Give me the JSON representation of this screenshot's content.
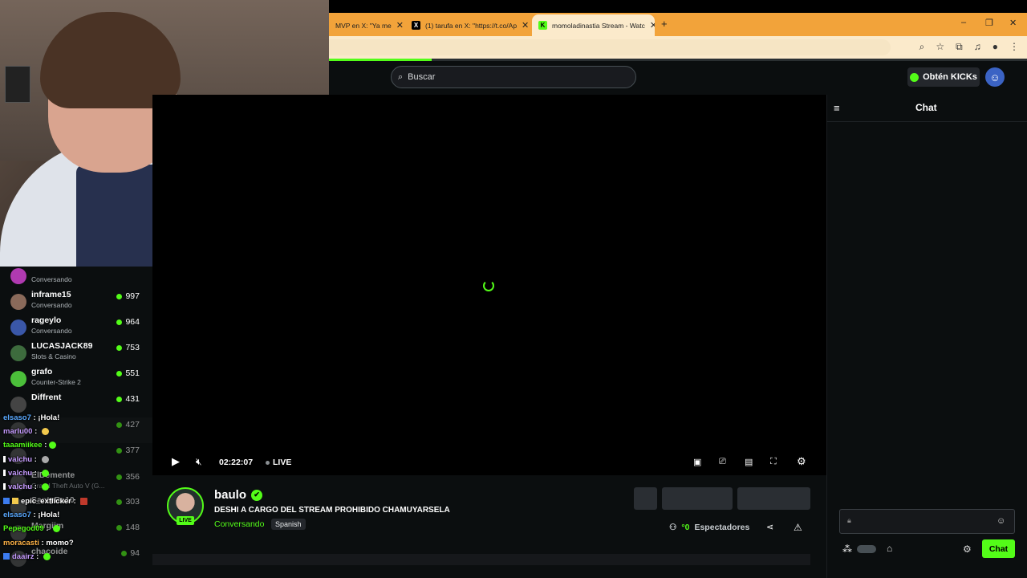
{
  "browser": {
    "tabs": [
      {
        "label": "MVP en X: \"Ya me",
        "icon": ""
      },
      {
        "label": "(1) tarufa en X: \"https://t.co/Ap",
        "icon": "X"
      },
      {
        "label": "momoladinastia Stream - Watc",
        "icon": "K"
      }
    ],
    "new_tab": "+",
    "window_controls": {
      "minimize": "–",
      "maximize": "❐",
      "close": "✕"
    }
  },
  "header": {
    "search_placeholder": "Buscar",
    "kicks_label": "Obtén KICKs"
  },
  "sidebar": {
    "channels": [
      {
        "name": "",
        "category": "Conversando",
        "viewers": ""
      },
      {
        "name": "inframe15",
        "category": "Conversando",
        "viewers": "997"
      },
      {
        "name": "rageylo",
        "category": "Conversando",
        "viewers": "964"
      },
      {
        "name": "LUCASJACK89",
        "category": "Slots & Casino",
        "viewers": "753"
      },
      {
        "name": "grafo",
        "category": "Counter-Strike 2",
        "viewers": "551"
      },
      {
        "name": "Diffrent",
        "category": "",
        "viewers": "431"
      },
      {
        "name": "",
        "category": "",
        "viewers": "427"
      },
      {
        "name": "",
        "category": "",
        "viewers": "377"
      },
      {
        "name": "ElDemente",
        "category": "Grand Theft Auto V (G...",
        "viewers": "356"
      },
      {
        "name": "SantyRa10",
        "category": "",
        "viewers": "303"
      },
      {
        "name": "Margiim",
        "category": "",
        "viewers": "148"
      },
      {
        "name": "chacoide",
        "category": "",
        "viewers": "94"
      }
    ]
  },
  "overlay_chat": [
    {
      "user": "elsaso7",
      "msg": "¡Hola!",
      "color": "#5aa9ff"
    },
    {
      "user": "marlu00",
      "msg": "",
      "color": "#c69cff"
    },
    {
      "user": "taaamiikee",
      "msg": "",
      "color": "#53fc18"
    },
    {
      "user": "valchu",
      "msg": "",
      "color": "#c69cff"
    },
    {
      "user": "valchu",
      "msg": "",
      "color": "#c69cff"
    },
    {
      "user": "valchu",
      "msg": "",
      "color": "#c69cff"
    },
    {
      "user": "epic_exflicker",
      "msg": "",
      "color": "#ffffff"
    },
    {
      "user": "elsaso7",
      "msg": "¡Hola!",
      "color": "#5aa9ff"
    },
    {
      "user": "Pepegod09",
      "msg": "",
      "color": "#53fc18"
    },
    {
      "user": "moracasti",
      "msg": "momo?",
      "color": "#ffb347"
    },
    {
      "user": "daairz",
      "msg": "",
      "color": "#c69cff"
    }
  ],
  "player": {
    "time": "02:22:07",
    "live_label": "LIVE"
  },
  "stream": {
    "streamer": "baulo",
    "live_badge": "LIVE",
    "title": "DESHI A CARGO DEL STREAM PROHIBIDO CHAMUYARSELA",
    "category": "Conversando",
    "language": "Spanish",
    "viewers_label": "Espectadores"
  },
  "chat": {
    "title": "Chat",
    "send_label": "Chat"
  },
  "colors": {
    "accent": "#53fc18",
    "bg": "#0b0e0f",
    "tabbar": "#f2a33a"
  }
}
